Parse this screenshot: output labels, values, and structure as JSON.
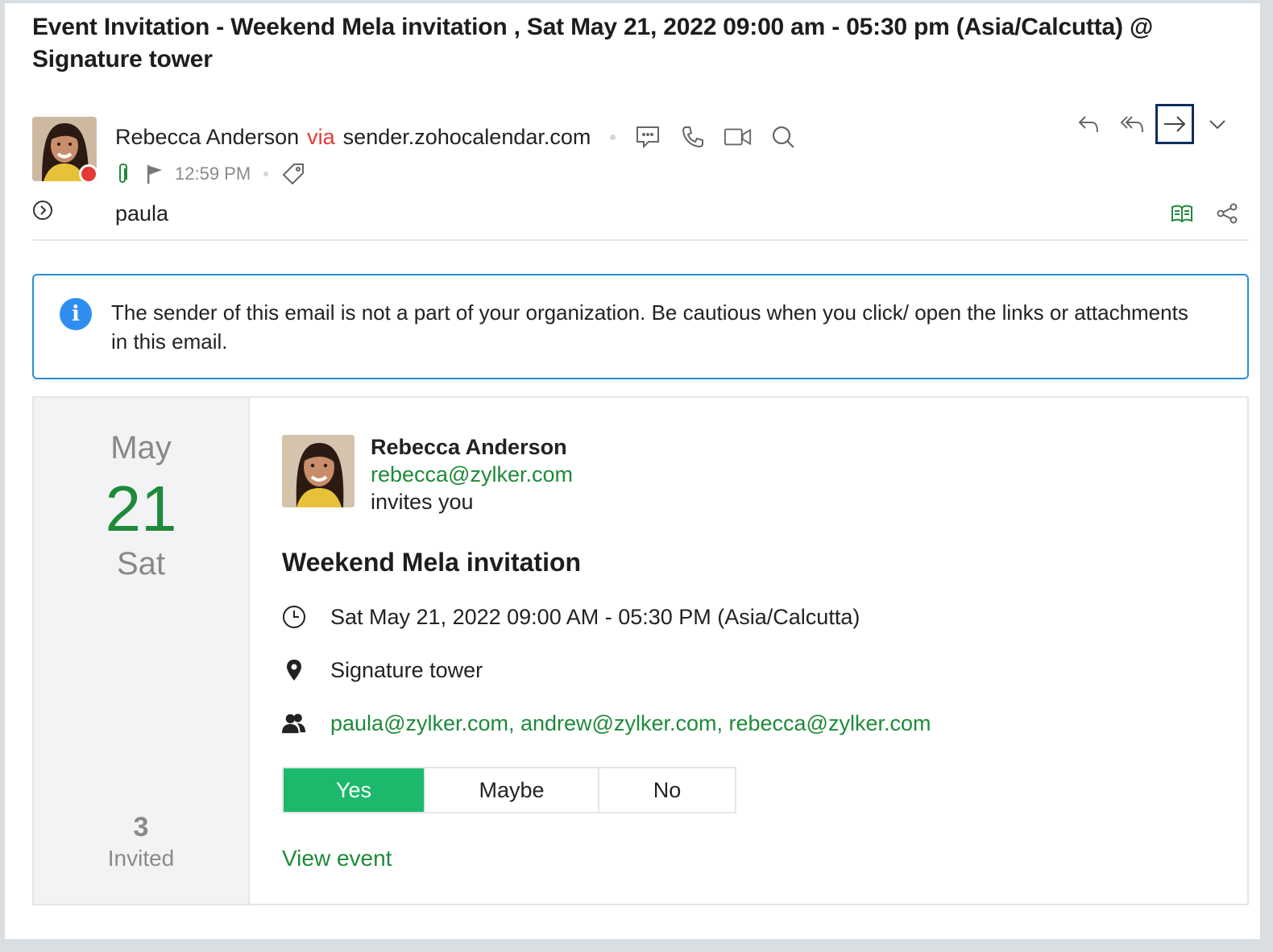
{
  "email": {
    "subject": "Event Invitation - Weekend Mela invitation , Sat May 21, 2022 09:00 am - 05:30 pm (Asia/Calcutta)  @ Signature tower",
    "sender_name": "Rebecca Anderson",
    "via_label": "via",
    "sender_domain": "sender.zohocalendar.com",
    "time": "12:59 PM",
    "recipient": "paula",
    "presence_color": "#e53935",
    "header_icons": [
      "chat-icon",
      "phone-icon",
      "video-icon",
      "search-icon"
    ],
    "meta_icons": [
      "attachment-icon",
      "flag-icon",
      "tag-icon"
    ],
    "actions": [
      "reply-icon",
      "reply-all-icon",
      "forward-icon",
      "chevron-down-icon"
    ],
    "tools": [
      "reading-view-icon",
      "share-icon"
    ]
  },
  "warning": {
    "icon": "info-icon",
    "text": "The sender of this email is not a part of your organization. Be cautious when you click/ open the links or attachments in this email."
  },
  "invite": {
    "month": "May",
    "day": "21",
    "weekday": "Sat",
    "invited_count": "3",
    "invited_label": "Invited",
    "organizer_name": "Rebecca Anderson",
    "organizer_email": "rebecca@zylker.com",
    "invites_text": "invites you",
    "title": "Weekend Mela invitation",
    "datetime": "Sat May 21, 2022 09:00 AM - 05:30 PM (Asia/Calcutta)",
    "location": "Signature tower",
    "attendees": "paula@zylker.com, andrew@zylker.com, rebecca@zylker.com",
    "rsvp": {
      "yes": "Yes",
      "maybe": "Maybe",
      "no": "No",
      "selected": "Yes"
    },
    "view_event": "View event"
  },
  "colors": {
    "accent_green": "#1e8a3a",
    "yes_button": "#1cb96c",
    "info_blue": "#2f8ef0",
    "active_action_border": "#0d2e5c",
    "warning_border": "#2a8fd6"
  }
}
